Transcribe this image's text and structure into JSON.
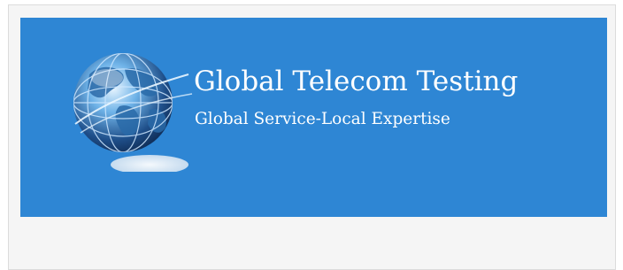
{
  "banner": {
    "background_color": "#2e86d4",
    "logo_icon": "globe-icon",
    "title": "Global Telecom Testing",
    "tagline": "Global Service-Local Expertise"
  }
}
